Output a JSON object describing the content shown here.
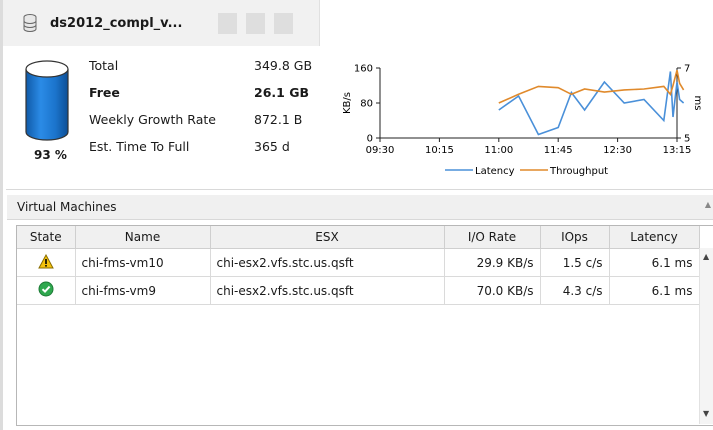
{
  "datastore": {
    "title": "ds2012_compl_v...",
    "percent_full": "93 %",
    "stats": [
      {
        "label": "Total",
        "value": "349.8 GB"
      },
      {
        "label": "Free",
        "value": "26.1 GB"
      },
      {
        "label": "Weekly Growth Rate",
        "value": "872.1 B"
      },
      {
        "label": "Est. Time To Full",
        "value": "365 d"
      }
    ],
    "icons": [
      "database-icon",
      "storage-cylinder-icon"
    ],
    "colors": {
      "cylinder": "#1b78d0",
      "header_bg": "#f1f1f1"
    }
  },
  "chart_data": {
    "type": "line",
    "x_ticks": [
      "09:30",
      "10:15",
      "11:00",
      "11:45",
      "12:30",
      "13:15"
    ],
    "y_left": {
      "label": "KB/s",
      "ticks": [
        "0",
        "80",
        "160"
      ],
      "ylim": [
        0,
        160
      ]
    },
    "y_right": {
      "label": "ms",
      "ticks": [
        "5",
        "7"
      ],
      "ylim": [
        5,
        7
      ]
    },
    "series": [
      {
        "name": "Latency",
        "axis": "right",
        "color": "#4a90d9",
        "x": [
          "11:00",
          "11:15",
          "11:30",
          "11:45",
          "11:55",
          "12:05",
          "12:20",
          "12:35",
          "12:50",
          "13:05",
          "13:10",
          "13:12",
          "13:15",
          "13:17",
          "13:20"
        ],
        "values": [
          5.8,
          6.2,
          5.1,
          5.3,
          6.3,
          5.8,
          6.6,
          6.0,
          6.1,
          5.5,
          6.9,
          5.6,
          6.6,
          6.1,
          6.0
        ]
      },
      {
        "name": "Throughput",
        "axis": "left",
        "color": "#e08a2c",
        "x": [
          "11:00",
          "11:15",
          "11:30",
          "11:45",
          "11:55",
          "12:05",
          "12:20",
          "12:35",
          "12:50",
          "13:05",
          "13:10",
          "13:12",
          "13:15",
          "13:17",
          "13:20"
        ],
        "values": [
          80,
          100,
          118,
          115,
          100,
          112,
          105,
          110,
          112,
          118,
          100,
          120,
          155,
          125,
          110
        ]
      }
    ],
    "legend_position": "bottom"
  },
  "vms": {
    "section_title": "Virtual Machines",
    "columns": [
      "State",
      "Name",
      "ESX",
      "I/O Rate",
      "IOps",
      "Latency"
    ],
    "rows": [
      {
        "state": "warning",
        "name": "chi-fms-vm10",
        "esx": "chi-esx2.vfs.stc.us.qsft",
        "io_rate": "29.9 KB/s",
        "iops": "1.5 c/s",
        "latency": "6.1 ms"
      },
      {
        "state": "ok",
        "name": "chi-fms-vm9",
        "esx": "chi-esx2.vfs.stc.us.qsft",
        "io_rate": "70.0 KB/s",
        "iops": "4.3 c/s",
        "latency": "6.1 ms"
      }
    ],
    "state_icons": {
      "warning": "warning-icon",
      "ok": "check-circle-icon"
    }
  }
}
